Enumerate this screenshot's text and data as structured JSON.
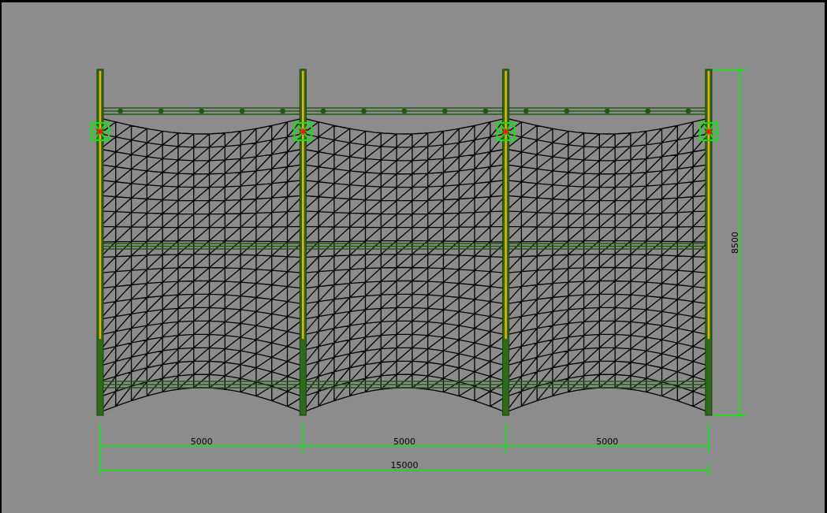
{
  "drawing": {
    "bays": [
      {
        "dimension": "5000"
      },
      {
        "dimension": "5000"
      },
      {
        "dimension": "5000"
      }
    ],
    "total_dimension": "15000",
    "height_dimension": "8500"
  }
}
